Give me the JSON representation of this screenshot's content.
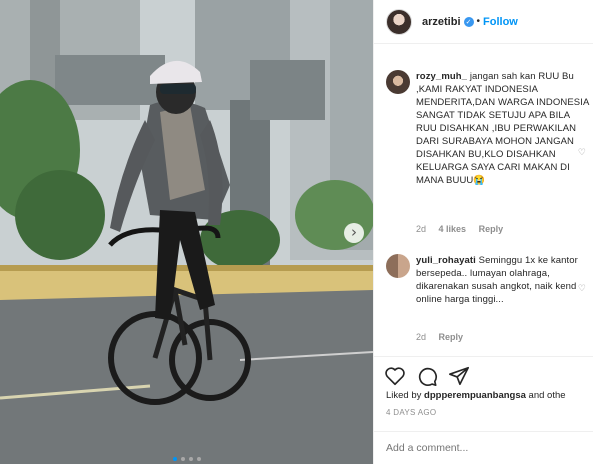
{
  "post": {
    "username": "arzetibi",
    "separator": "•",
    "follow_label": "Follow",
    "verified_icon": "checkmark-badge-icon",
    "carousel_next": "›"
  },
  "comments": [
    {
      "username": "rozy_muh_",
      "text": "jangan sah kan RUU Bu ,KAMI RAKYAT INDONESIA MENDERITA,DAN WARGA INDONESIA SANGAT TIDAK SETUJU APA BILA RUU DISAHKAN ,IBU PERWAKILAN DARI SURABAYA MOHON JANGAN DISAHKAN BU,KLO DISAHKAN KELUARGA SAYA CARI MAKAN DI MANA BUUU😭",
      "age": "2d",
      "likes": "4 likes",
      "reply": "Reply"
    },
    {
      "username": "yuli_rohayati",
      "text": "Seminggu 1x ke kantor bersepeda.. lumayan olahraga, dikarenakan susah angkot, naik kend online harga tinggi...",
      "age": "2d",
      "likes": "",
      "reply": "Reply"
    }
  ],
  "actions": {
    "like_icon": "heart-icon",
    "comment_icon": "comment-icon",
    "share_icon": "paper-plane-icon"
  },
  "liked_by": {
    "prefix": "Liked by ",
    "user": "dppperempuanbangsa",
    "suffix": " and othe"
  },
  "timestamp": "4 DAYS AGO",
  "add_comment": {
    "placeholder": "Add a comment..."
  },
  "colors": {
    "accent": "#0095f6",
    "muted": "#8e8e8e",
    "text": "#262626"
  }
}
